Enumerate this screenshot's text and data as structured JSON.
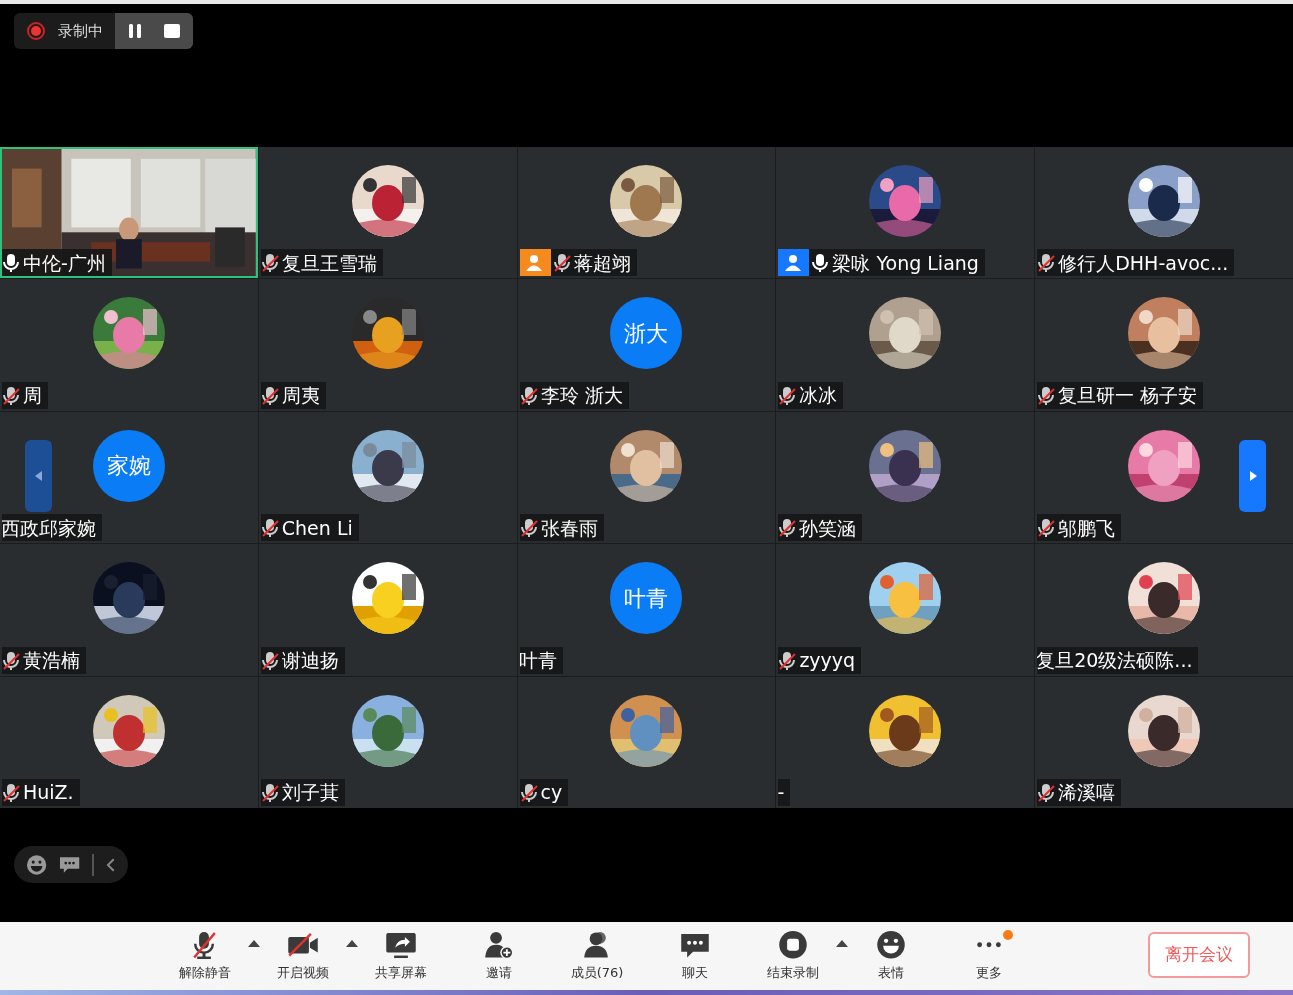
{
  "recording": {
    "label": "录制中",
    "paused": false
  },
  "tiles": [
    {
      "name": "中伦-广州",
      "muted": false,
      "avatar": {
        "kind": "video"
      },
      "speaking": true
    },
    {
      "name": "复旦王雪瑞",
      "muted": true,
      "speaking": false
    },
    {
      "name": "蒋超翊",
      "muted": true,
      "badge": {
        "color": "#f58a1f"
      },
      "speaking": false
    },
    {
      "name": "梁咏 Yong Liang",
      "muted": false,
      "badge": {
        "color": "#1677ff"
      },
      "speaking": false
    },
    {
      "name": "修行人DHH-avoc...",
      "muted": true,
      "speaking": false
    },
    {
      "name": "周",
      "muted": true,
      "speaking": false
    },
    {
      "name": "周夷",
      "muted": true,
      "speaking": false
    },
    {
      "name": "李玲 浙大",
      "muted": true,
      "avatar": {
        "kind": "text",
        "text": "浙大"
      },
      "speaking": false
    },
    {
      "name": "冰冰",
      "muted": true,
      "speaking": false
    },
    {
      "name": "复旦研一 杨子安",
      "muted": true,
      "speaking": false
    },
    {
      "name": "西政邱家婉",
      "avatar": {
        "kind": "text",
        "text": "家婉"
      },
      "speaking": false
    },
    {
      "name": "Chen Li",
      "muted": true,
      "speaking": false
    },
    {
      "name": "张春雨",
      "muted": true,
      "speaking": false
    },
    {
      "name": "孙笑涵",
      "muted": true,
      "speaking": false
    },
    {
      "name": "邬鹏飞",
      "muted": true,
      "speaking": false
    },
    {
      "name": "黄浩楠",
      "muted": true,
      "speaking": false
    },
    {
      "name": "谢迪扬",
      "muted": true,
      "speaking": false
    },
    {
      "name": "叶青",
      "avatar": {
        "kind": "text",
        "text": "叶青"
      },
      "speaking": false
    },
    {
      "name": "zyyyq",
      "muted": true,
      "speaking": false
    },
    {
      "name": "复旦20级法硕陈...",
      "speaking": false
    },
    {
      "name": "HuiZ.",
      "muted": true,
      "speaking": false
    },
    {
      "name": "刘子萁",
      "muted": true,
      "speaking": false
    },
    {
      "name": "cy",
      "muted": true,
      "speaking": false
    },
    {
      "name": "-",
      "speaking": false
    },
    {
      "name": "浠溪嘻",
      "muted": true,
      "speaking": false
    }
  ],
  "pager": {
    "prev_disabled": true,
    "next_disabled": false
  },
  "toolbar": [
    {
      "kind": "mic-off",
      "label": "解除静音",
      "caret": true
    },
    {
      "kind": "video-off",
      "label": "开启视频",
      "caret": true
    },
    {
      "kind": "share",
      "label": "共享屏幕",
      "caret": false
    },
    {
      "kind": "invite",
      "label": "邀请",
      "caret": false
    },
    {
      "kind": "members",
      "label": "成员(76)",
      "caret": false
    },
    {
      "kind": "chat",
      "label": "聊天",
      "caret": false
    },
    {
      "kind": "stop-record",
      "label": "结束录制",
      "caret": true
    },
    {
      "kind": "emoji",
      "label": "表情",
      "caret": false
    },
    {
      "kind": "more",
      "label": "更多",
      "caret": false,
      "dot": true
    }
  ],
  "leave_button": "离开会议"
}
